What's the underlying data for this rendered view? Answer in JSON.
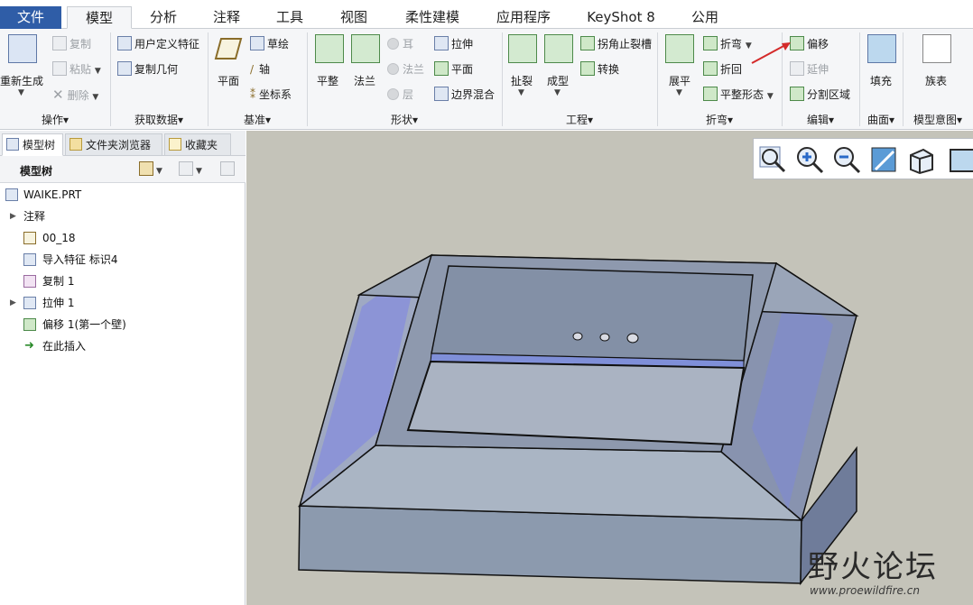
{
  "tabs": [
    "文件",
    "模型",
    "分析",
    "注释",
    "工具",
    "视图",
    "柔性建模",
    "应用程序",
    "KeyShot 8",
    "公用"
  ],
  "active_tab": "模型",
  "ribbon": {
    "operations": {
      "label": "操作▾",
      "regen": "重新生成",
      "copy": "复制",
      "paste": "粘贴",
      "delete": "删除"
    },
    "get_data": {
      "label": "获取数据▾",
      "user_feature": "用户定义特征",
      "copy_geom": "复制几何"
    },
    "datum": {
      "label": "基准▾",
      "plane": "平面",
      "sketch": "草绘",
      "axis": "轴",
      "csys": "坐标系"
    },
    "shapes": {
      "label": "形状▾",
      "flat": "平整",
      "flange": "法兰",
      "lip": "耳",
      "flange2": "法兰",
      "layer": "层",
      "extrude": "拉伸",
      "plane": "平面",
      "boundary_blend": "边界混合"
    },
    "engineering": {
      "label": "工程▾",
      "rip": "扯裂",
      "form": "成型",
      "corner_relief": "拐角止裂槽",
      "convert": "转换"
    },
    "bend": {
      "label": "折弯▾",
      "unbend": "展平",
      "bend": "折弯",
      "bend_back": "折回",
      "flat_pattern": "平整形态"
    },
    "edit": {
      "label": "编辑▾",
      "offset": "偏移",
      "extend": "延伸",
      "split_area": "分割区域"
    },
    "surface": {
      "label": "曲面▾",
      "fill": "填充"
    },
    "intent": {
      "label": "模型意图▾",
      "family": "族表"
    }
  },
  "nav_tabs": [
    "模型树",
    "文件夹浏览器",
    "收藏夹"
  ],
  "tree_toolbar_title": "模型树",
  "tree": [
    {
      "label": "WAIKE.PRT",
      "expandable": false
    },
    {
      "label": "注释",
      "expandable": true
    },
    {
      "label": "00_18",
      "expandable": false
    },
    {
      "label": "导入特征 标识4",
      "expandable": false
    },
    {
      "label": "复制 1",
      "expandable": false
    },
    {
      "label": "拉伸 1",
      "expandable": true
    },
    {
      "label": "偏移 1(第一个壁)",
      "expandable": false
    },
    {
      "label": "在此插入",
      "expandable": false
    }
  ],
  "watermark": {
    "title": "野火论坛",
    "url": "www.proewildfire.cn"
  },
  "colors": {
    "file_tab": "#2f5da7",
    "viewport_bg": "#c4c3b9",
    "part_face": "#8d9bb1",
    "part_highlight": "#7b84e6",
    "annotation_arrow": "#d42a2a"
  }
}
